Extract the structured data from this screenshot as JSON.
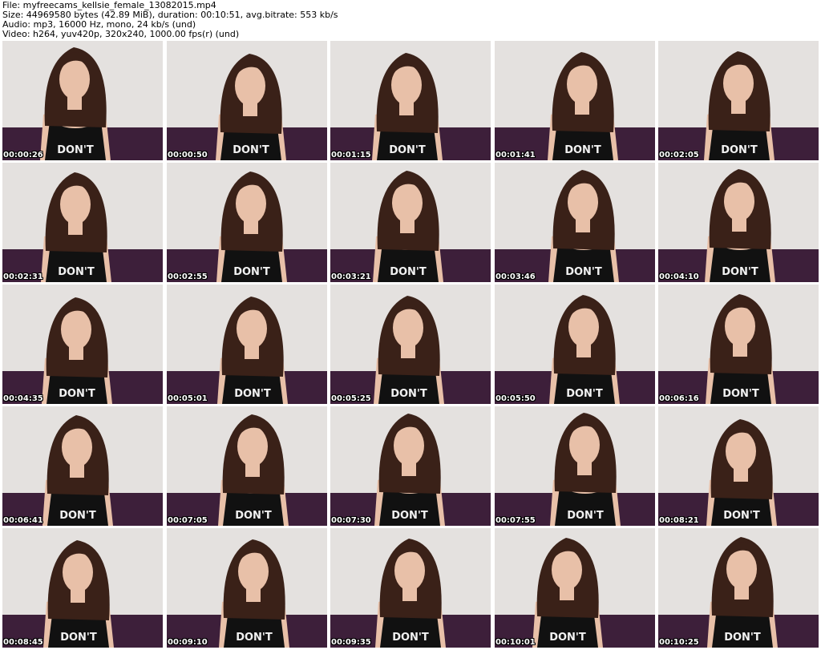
{
  "header": {
    "file": "File: myfreecams_kellsie_female_13082015.mp4",
    "size": "Size: 44969580 bytes (42.89 MiB), duration: 00:10:51, avg.bitrate: 553 kb/s",
    "audio": "Audio: mp3, 16000 Hz, mono, 24 kb/s (und)",
    "video": "Video: h264, yuv420p, 320x240, 1000.00 fps(r) (und)"
  },
  "thumbnails": [
    {
      "timestamp": "00:00:26"
    },
    {
      "timestamp": "00:00:50"
    },
    {
      "timestamp": "00:01:15"
    },
    {
      "timestamp": "00:01:41"
    },
    {
      "timestamp": "00:02:05"
    },
    {
      "timestamp": "00:02:31"
    },
    {
      "timestamp": "00:02:55"
    },
    {
      "timestamp": "00:03:21"
    },
    {
      "timestamp": "00:03:46"
    },
    {
      "timestamp": "00:04:10"
    },
    {
      "timestamp": "00:04:35"
    },
    {
      "timestamp": "00:05:01"
    },
    {
      "timestamp": "00:05:25"
    },
    {
      "timestamp": "00:05:50"
    },
    {
      "timestamp": "00:06:16"
    },
    {
      "timestamp": "00:06:41"
    },
    {
      "timestamp": "00:07:05"
    },
    {
      "timestamp": "00:07:30"
    },
    {
      "timestamp": "00:07:55"
    },
    {
      "timestamp": "00:08:21"
    },
    {
      "timestamp": "00:08:45"
    },
    {
      "timestamp": "00:09:10"
    },
    {
      "timestamp": "00:09:35"
    },
    {
      "timestamp": "00:10:01"
    },
    {
      "timestamp": "00:10:25"
    }
  ],
  "colors": {
    "wall": "#e4e1df",
    "sofa": "#3d1f3a",
    "hair": "#3a2118",
    "skin": "#e8c0a8",
    "top": "#111111",
    "shirt_text": "#f2f2f2"
  }
}
